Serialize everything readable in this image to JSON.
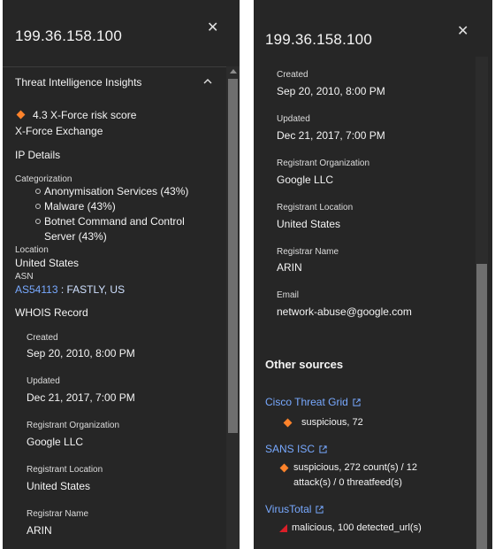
{
  "left": {
    "title": "199.36.158.100",
    "section_title": "Threat Intelligence Insights",
    "risk_score": "4.3 X-Force risk score",
    "source": "X-Force Exchange",
    "ip_details": "IP Details",
    "categorization_label": "Categorization",
    "categories": [
      "Anonymisation Services (43%)",
      "Malware (43%)",
      "Botnet Command and Control",
      "Server (43%)"
    ],
    "location_label": "Location",
    "location_value": "United States",
    "asn_label": "ASN",
    "asn_link": "AS54113",
    "asn_rest": " : FASTLY, US",
    "whois_title": "WHOIS Record",
    "created_label": "Created",
    "created_value": "Sep 20, 2010, 8:00 PM",
    "updated_label": "Updated",
    "updated_value": "Dec 21, 2017, 7:00 PM",
    "reg_org_label": "Registrant Organization",
    "reg_org_value": "Google LLC",
    "reg_loc_label": "Registrant Location",
    "reg_loc_value": "United States",
    "registrar_label": "Registrar Name",
    "registrar_value": "ARIN"
  },
  "right": {
    "title": "199.36.158.100",
    "created_label": "Created",
    "created_value": "Sep 20, 2010, 8:00 PM",
    "updated_label": "Updated",
    "updated_value": "Dec 21, 2017, 7:00 PM",
    "reg_org_label": "Registrant Organization",
    "reg_org_value": "Google LLC",
    "reg_loc_label": "Registrant Location",
    "reg_loc_value": "United States",
    "registrar_label": "Registrar Name",
    "registrar_value": "ARIN",
    "email_label": "Email",
    "email_value": "network-abuse@google.com",
    "other_sources_title": "Other sources",
    "sources": [
      {
        "name": "Cisco Threat Grid",
        "result": "suspicious, 72"
      },
      {
        "name": "SANS ISC",
        "result_line1": "suspicious, 272 count(s) / 12",
        "result_line2": "attack(s) / 0 threatfeed(s)"
      },
      {
        "name": "VirusTotal",
        "result": "malicious, 100 detected_url(s)"
      }
    ]
  },
  "colors": {
    "panel_bg": "#262626",
    "link": "#78a9ff",
    "suspicious": "#ff832b",
    "malicious": "#da1e28"
  },
  "icons": {
    "close": "close-icon",
    "collapse": "chevron-up-icon",
    "external": "external-link-icon",
    "risk": "diamond-icon",
    "malicious": "triangle-icon"
  }
}
